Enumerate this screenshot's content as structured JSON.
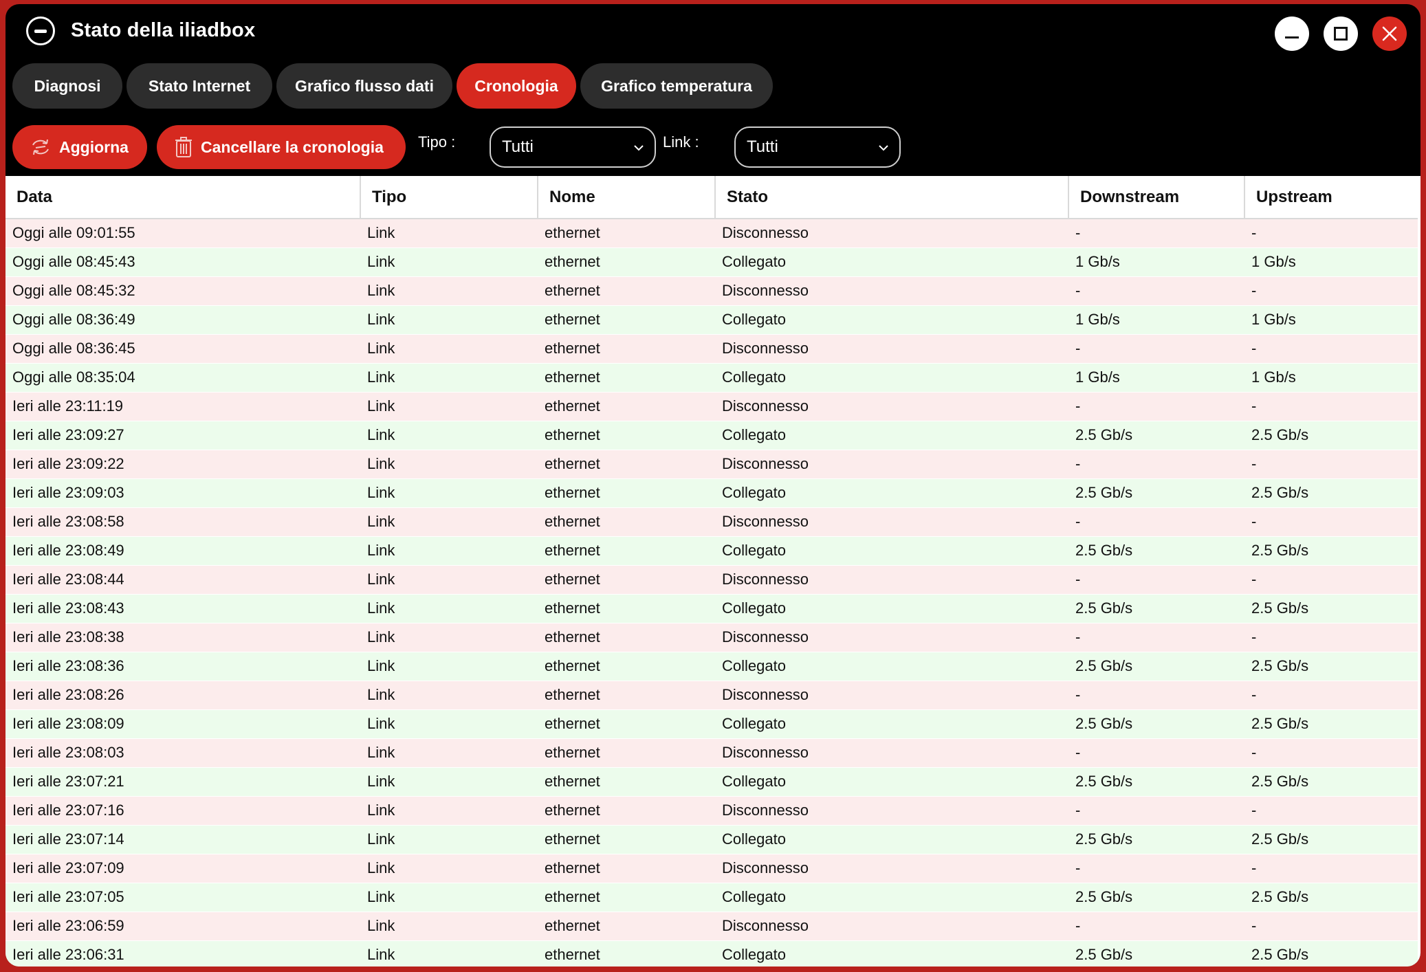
{
  "window": {
    "title": "Stato della iliadbox"
  },
  "tabs": [
    {
      "label": "Diagnosi",
      "active": false
    },
    {
      "label": "Stato Internet",
      "active": false
    },
    {
      "label": "Grafico flusso dati",
      "active": false
    },
    {
      "label": "Cronologia",
      "active": true
    },
    {
      "label": "Grafico temperatura",
      "active": false
    }
  ],
  "toolbar": {
    "refresh_label": "Aggiorna",
    "clear_label": "Cancellare la cronologia",
    "type_filter_label": "Tipo :",
    "type_filter_value": "Tutti",
    "link_filter_label": "Link :",
    "link_filter_value": "Tutti"
  },
  "colors": {
    "accent": "#d6291f",
    "row_disconnected": "#fcecec",
    "row_connected": "#ecfcec"
  },
  "table": {
    "columns": [
      "Data",
      "Tipo",
      "Nome",
      "Stato",
      "Downstream",
      "Upstream"
    ],
    "rows": [
      [
        "Oggi alle 09:01:55",
        "Link",
        "ethernet",
        "Disconnesso",
        "-",
        "-"
      ],
      [
        "Oggi alle 08:45:43",
        "Link",
        "ethernet",
        "Collegato",
        "1 Gb/s",
        "1 Gb/s"
      ],
      [
        "Oggi alle 08:45:32",
        "Link",
        "ethernet",
        "Disconnesso",
        "-",
        "-"
      ],
      [
        "Oggi alle 08:36:49",
        "Link",
        "ethernet",
        "Collegato",
        "1 Gb/s",
        "1 Gb/s"
      ],
      [
        "Oggi alle 08:36:45",
        "Link",
        "ethernet",
        "Disconnesso",
        "-",
        "-"
      ],
      [
        "Oggi alle 08:35:04",
        "Link",
        "ethernet",
        "Collegato",
        "1 Gb/s",
        "1 Gb/s"
      ],
      [
        "Ieri alle 23:11:19",
        "Link",
        "ethernet",
        "Disconnesso",
        "-",
        "-"
      ],
      [
        "Ieri alle 23:09:27",
        "Link",
        "ethernet",
        "Collegato",
        "2.5 Gb/s",
        "2.5 Gb/s"
      ],
      [
        "Ieri alle 23:09:22",
        "Link",
        "ethernet",
        "Disconnesso",
        "-",
        "-"
      ],
      [
        "Ieri alle 23:09:03",
        "Link",
        "ethernet",
        "Collegato",
        "2.5 Gb/s",
        "2.5 Gb/s"
      ],
      [
        "Ieri alle 23:08:58",
        "Link",
        "ethernet",
        "Disconnesso",
        "-",
        "-"
      ],
      [
        "Ieri alle 23:08:49",
        "Link",
        "ethernet",
        "Collegato",
        "2.5 Gb/s",
        "2.5 Gb/s"
      ],
      [
        "Ieri alle 23:08:44",
        "Link",
        "ethernet",
        "Disconnesso",
        "-",
        "-"
      ],
      [
        "Ieri alle 23:08:43",
        "Link",
        "ethernet",
        "Collegato",
        "2.5 Gb/s",
        "2.5 Gb/s"
      ],
      [
        "Ieri alle 23:08:38",
        "Link",
        "ethernet",
        "Disconnesso",
        "-",
        "-"
      ],
      [
        "Ieri alle 23:08:36",
        "Link",
        "ethernet",
        "Collegato",
        "2.5 Gb/s",
        "2.5 Gb/s"
      ],
      [
        "Ieri alle 23:08:26",
        "Link",
        "ethernet",
        "Disconnesso",
        "-",
        "-"
      ],
      [
        "Ieri alle 23:08:09",
        "Link",
        "ethernet",
        "Collegato",
        "2.5 Gb/s",
        "2.5 Gb/s"
      ],
      [
        "Ieri alle 23:08:03",
        "Link",
        "ethernet",
        "Disconnesso",
        "-",
        "-"
      ],
      [
        "Ieri alle 23:07:21",
        "Link",
        "ethernet",
        "Collegato",
        "2.5 Gb/s",
        "2.5 Gb/s"
      ],
      [
        "Ieri alle 23:07:16",
        "Link",
        "ethernet",
        "Disconnesso",
        "-",
        "-"
      ],
      [
        "Ieri alle 23:07:14",
        "Link",
        "ethernet",
        "Collegato",
        "2.5 Gb/s",
        "2.5 Gb/s"
      ],
      [
        "Ieri alle 23:07:09",
        "Link",
        "ethernet",
        "Disconnesso",
        "-",
        "-"
      ],
      [
        "Ieri alle 23:07:05",
        "Link",
        "ethernet",
        "Collegato",
        "2.5 Gb/s",
        "2.5 Gb/s"
      ],
      [
        "Ieri alle 23:06:59",
        "Link",
        "ethernet",
        "Disconnesso",
        "-",
        "-"
      ],
      [
        "Ieri alle 23:06:31",
        "Link",
        "ethernet",
        "Collegato",
        "2.5 Gb/s",
        "2.5 Gb/s"
      ]
    ]
  }
}
